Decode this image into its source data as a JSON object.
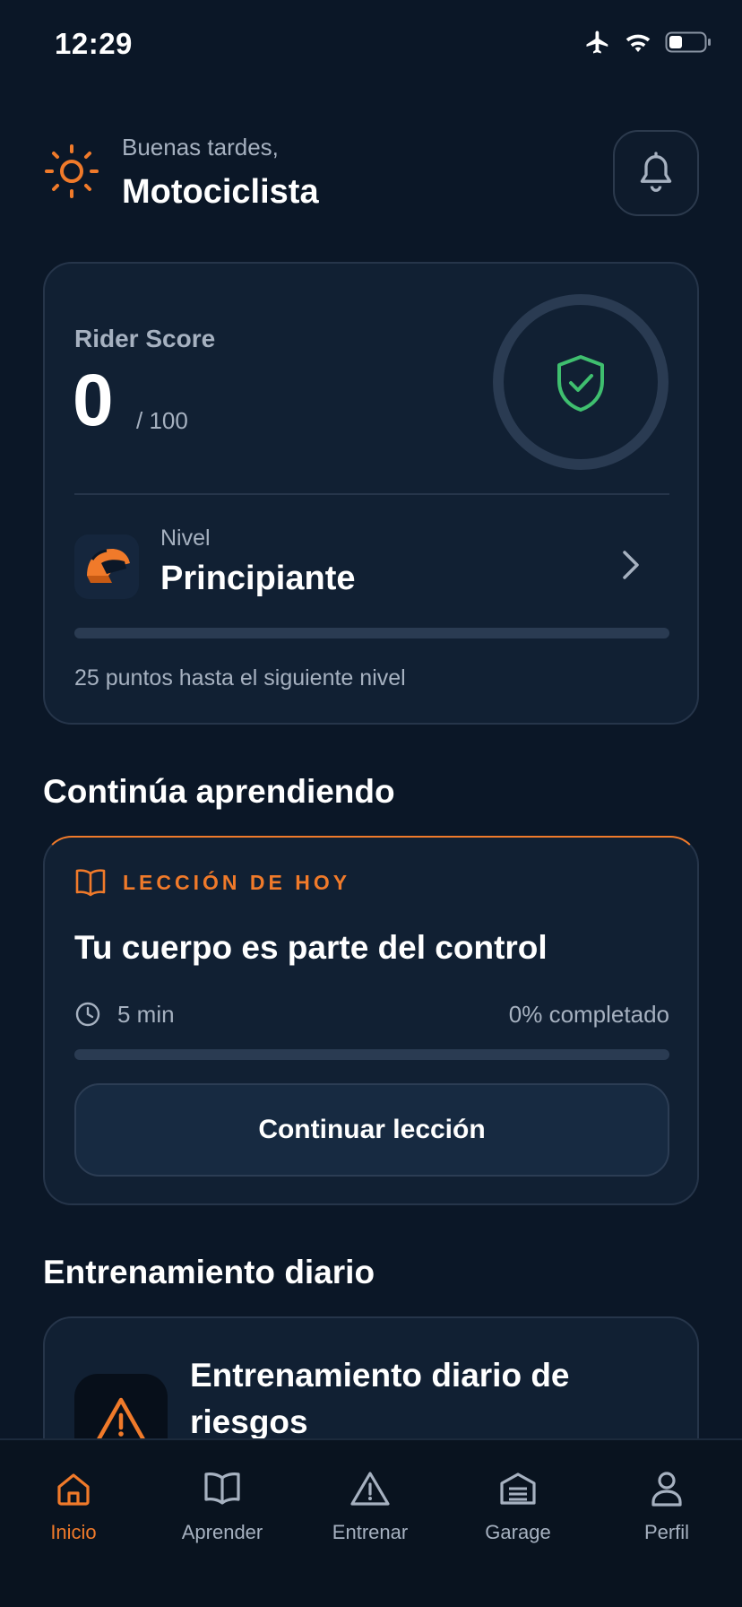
{
  "status_bar": {
    "time": "12:29",
    "icons": [
      "airplane-icon",
      "wifi-icon",
      "battery-icon"
    ]
  },
  "header": {
    "greeting": "Buenas tardes,",
    "user_name": "Motociclista",
    "icons": [
      "sun-icon",
      "bell-icon"
    ]
  },
  "score_card": {
    "label": "Rider Score",
    "value": "0",
    "max": "/ 100",
    "ring_icon": "shield-check-icon",
    "level_caption": "Nivel",
    "level_name": "Principiante",
    "level_progress_percent": 0,
    "next_level_text": "25 puntos hasta el siguiente nivel"
  },
  "learning": {
    "section_title": "Continúa aprendiendo",
    "tag": "LECCIÓN DE HOY",
    "lesson_title": "Tu cuerpo es parte del control",
    "duration": "5 min",
    "completion": "0% completado",
    "progress_percent": 0,
    "button_label": "Continuar lección"
  },
  "training": {
    "section_title": "Entrenamiento diario",
    "card_title": "Entrenamiento diario de riesgos",
    "icon": "warning-icon"
  },
  "tab_bar": {
    "tabs": [
      {
        "label": "Inicio",
        "icon": "home-icon",
        "active": true
      },
      {
        "label": "Aprender",
        "icon": "book-icon",
        "active": false
      },
      {
        "label": "Entrenar",
        "icon": "warning-icon",
        "active": false
      },
      {
        "label": "Garage",
        "icon": "garage-icon",
        "active": false
      },
      {
        "label": "Perfil",
        "icon": "person-icon",
        "active": false
      }
    ]
  },
  "colors": {
    "background": "#0b1727",
    "card": "#112033",
    "accent": "#f07a2a",
    "success": "#3fbf6f",
    "muted_text": "#a6b1c0"
  }
}
